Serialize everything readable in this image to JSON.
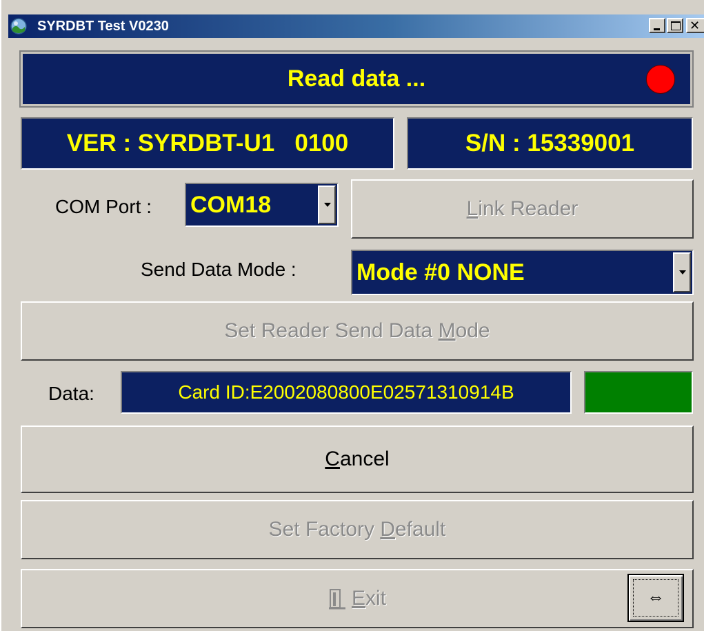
{
  "window": {
    "title": "SYRDBT Test  V0230"
  },
  "status": {
    "text": "Read data ...",
    "led_color": "#ff0000"
  },
  "info": {
    "version": "VER : SYRDBT-U1   0100",
    "serial": "S/N : 15339001"
  },
  "com_port": {
    "label": "COM Port :",
    "value": "COM18"
  },
  "buttons": {
    "link_reader": {
      "prefix": "",
      "mnemonic": "L",
      "rest": "ink Reader"
    },
    "set_mode": {
      "prefix": "Set Reader Send Data ",
      "mnemonic": "M",
      "rest": "ode"
    },
    "cancel": {
      "prefix": "",
      "mnemonic": "C",
      "rest": "ancel"
    },
    "factory": {
      "prefix": "Set Factory ",
      "mnemonic": "D",
      "rest": "efault"
    },
    "exit": {
      "prefix": "",
      "mnemonic": "E",
      "rest": "xit"
    },
    "toggle_glyph": "⇔"
  },
  "send_mode": {
    "label": "Send Data Mode :",
    "value": "Mode #0 NONE"
  },
  "data": {
    "label": "Data:",
    "value": "Card ID:E2002080800E02571310914B",
    "led_color": "#008000"
  },
  "colors": {
    "panel": "#0c2061",
    "text_accent": "#ffff00",
    "face": "#d4d0c8"
  }
}
